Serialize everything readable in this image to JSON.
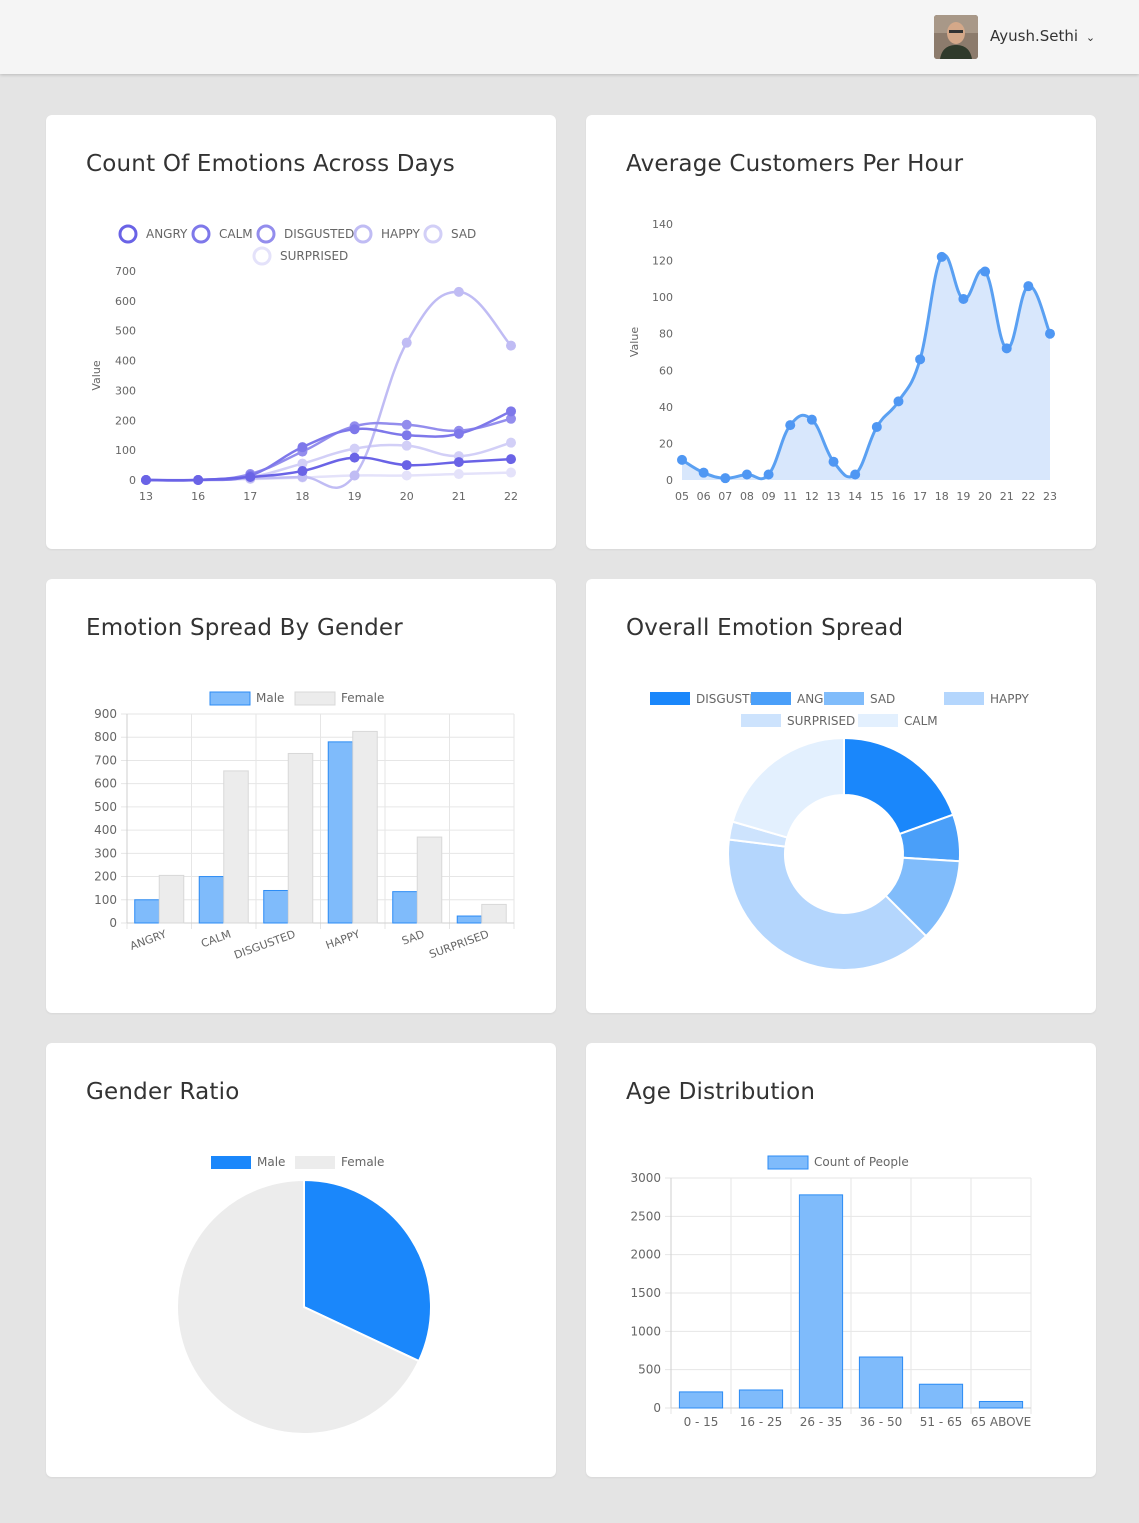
{
  "header": {
    "user_name": "Ayush.Sethi",
    "dropdown_icon": "chevron-down-icon",
    "avatar_icon": "user-avatar"
  },
  "cards": {
    "emotions_days": {
      "title": "Count Of Emotions Across Days"
    },
    "customers_hour": {
      "title": "Average Customers Per Hour"
    },
    "emotion_gender": {
      "title": "Emotion Spread By Gender"
    },
    "overall_emotion": {
      "title": "Overall Emotion Spread"
    },
    "gender_ratio": {
      "title": "Gender Ratio"
    },
    "age_distribution": {
      "title": "Age Distribution"
    }
  },
  "chart_data": [
    {
      "id": "emotions_days",
      "type": "line",
      "title": "Count Of Emotions Across Days",
      "ylabel": "Value",
      "x": [
        "13",
        "16",
        "17",
        "18",
        "19",
        "20",
        "21",
        "22"
      ],
      "ylim": [
        0,
        700
      ],
      "yticks": [
        0,
        100,
        200,
        300,
        400,
        500,
        600,
        700
      ],
      "legend": "top",
      "series": [
        {
          "name": "ANGRY",
          "color": "#6a63e6",
          "values": [
            0,
            0,
            10,
            30,
            75,
            50,
            60,
            70
          ]
        },
        {
          "name": "CALM",
          "color": "#7e78ea",
          "values": [
            0,
            0,
            15,
            110,
            170,
            150,
            155,
            230
          ]
        },
        {
          "name": "DISGUSTED",
          "color": "#938ded",
          "values": [
            0,
            0,
            20,
            95,
            180,
            185,
            165,
            205
          ]
        },
        {
          "name": "HAPPY",
          "color": "#c0bcf4",
          "values": [
            0,
            0,
            5,
            10,
            15,
            460,
            630,
            450
          ]
        },
        {
          "name": "SAD",
          "color": "#d2cff7",
          "values": [
            0,
            0,
            10,
            55,
            105,
            115,
            80,
            125
          ]
        },
        {
          "name": "SURPRISED",
          "color": "#e4e2fa",
          "values": [
            0,
            0,
            3,
            8,
            15,
            15,
            20,
            25
          ]
        }
      ]
    },
    {
      "id": "customers_hour",
      "type": "area",
      "title": "Average Customers Per Hour",
      "ylabel": "Value",
      "x": [
        "05",
        "06",
        "07",
        "08",
        "09",
        "11",
        "12",
        "13",
        "14",
        "15",
        "16",
        "17",
        "18",
        "19",
        "20",
        "21",
        "22",
        "23"
      ],
      "values": [
        11,
        4,
        1,
        3,
        3,
        30,
        33,
        10,
        3,
        29,
        43,
        66,
        122,
        99,
        114,
        72,
        106,
        80
      ],
      "ylim": [
        0,
        140
      ],
      "yticks": [
        0,
        20,
        40,
        60,
        80,
        100,
        120,
        140
      ],
      "color": "#5aa0f2",
      "fill": "#d8e7fc"
    },
    {
      "id": "emotion_gender",
      "type": "bar",
      "title": "Emotion Spread By Gender",
      "categories": [
        "ANGRY",
        "CALM",
        "DISGUSTED",
        "HAPPY",
        "SAD",
        "SURPRISED"
      ],
      "ylim": [
        0,
        900
      ],
      "yticks": [
        0,
        100,
        200,
        300,
        400,
        500,
        600,
        700,
        800,
        900
      ],
      "legend": "top",
      "series": [
        {
          "name": "Male",
          "color": "#7fbbfb",
          "border": "#2b8bf5",
          "values": [
            100,
            200,
            140,
            780,
            135,
            30
          ]
        },
        {
          "name": "Female",
          "color": "#ececec",
          "border": "#d8d8d8",
          "values": [
            205,
            655,
            730,
            825,
            370,
            80
          ]
        }
      ]
    },
    {
      "id": "overall_emotion",
      "type": "pie",
      "title": "Overall Emotion Spread",
      "donut": true,
      "legend": "top",
      "labels": [
        "DISGUSTED",
        "ANGRY",
        "SAD",
        "HAPPY",
        "SURPRISED",
        "CALM"
      ],
      "values": [
        19.5,
        6.5,
        11.5,
        39.5,
        2.5,
        20.5
      ],
      "colors": [
        "#1a87fb",
        "#4a9ff9",
        "#80bcfb",
        "#b4d6fd",
        "#cde3fd",
        "#e3f0fe"
      ]
    },
    {
      "id": "gender_ratio",
      "type": "pie",
      "title": "Gender Ratio",
      "legend": "top",
      "labels": [
        "Male",
        "Female"
      ],
      "values": [
        32,
        68
      ],
      "colors": [
        "#1a87fb",
        "#ececec"
      ]
    },
    {
      "id": "age_distribution",
      "type": "bar",
      "title": "Age Distribution",
      "categories": [
        "0 - 15",
        "16 - 25",
        "26 - 35",
        "36 - 50",
        "51 - 65",
        "65 ABOVE"
      ],
      "ylim": [
        0,
        3000
      ],
      "yticks": [
        0,
        500,
        1000,
        1500,
        2000,
        2500,
        3000
      ],
      "legend": "top",
      "series": [
        {
          "name": "Count of People",
          "color": "#7fbbfb",
          "border": "#2b8bf5",
          "values": [
            210,
            235,
            2780,
            665,
            310,
            85
          ]
        }
      ]
    }
  ]
}
